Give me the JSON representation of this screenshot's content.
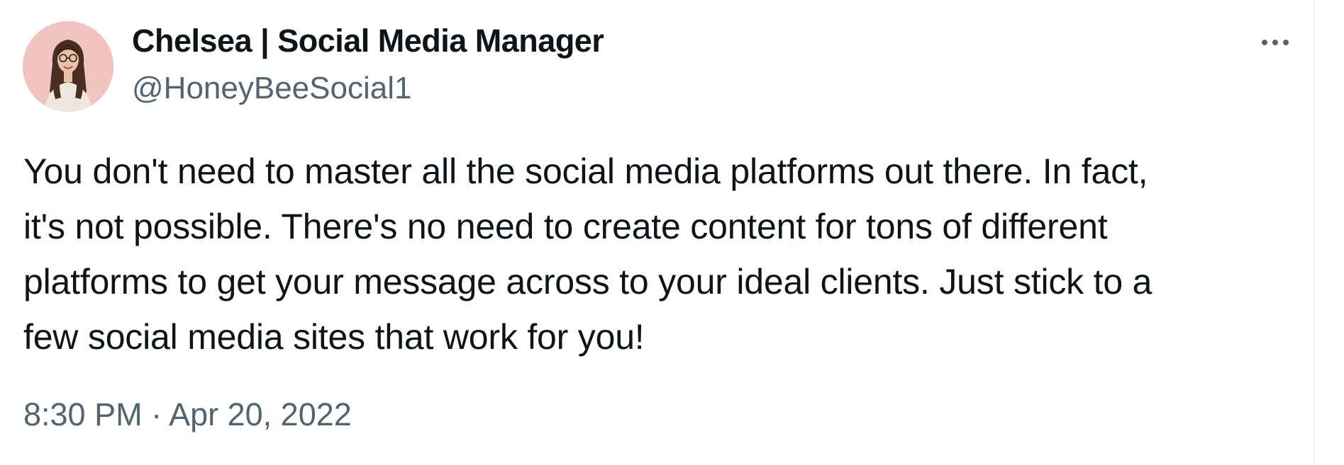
{
  "author": {
    "display_name": "Chelsea | Social Media Manager",
    "handle": "@HoneyBeeSocial1",
    "avatar_icon": "profile-photo"
  },
  "menu": {
    "more_icon": "more-horizontal-icon"
  },
  "tweet": {
    "text_lines": [
      "You don't need to master all the social media platforms out there. In fact,",
      "it's not possible. There's no need to create content for tons of different",
      "platforms to get your message across to your ideal clients. Just stick to a",
      "few social media sites that work for you!"
    ],
    "timestamp": "8:30 PM · Apr 20, 2022"
  },
  "colors": {
    "text_primary": "#0f1419",
    "text_secondary": "#536471",
    "avatar_bg": "#f2c4c0"
  }
}
